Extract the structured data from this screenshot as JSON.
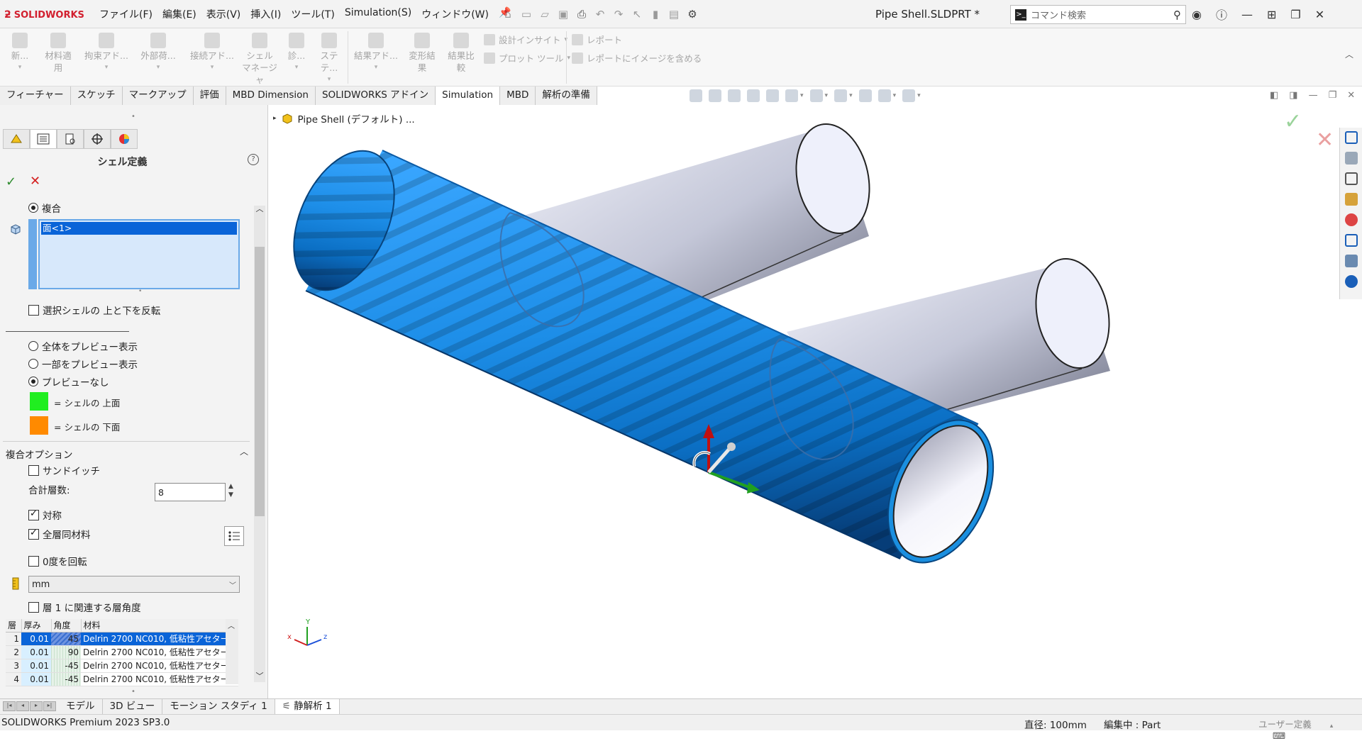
{
  "app": {
    "brand": "SOLIDWORKS",
    "document_title": "Pipe Shell.SLDPRT *",
    "menu": [
      "ファイル(F)",
      "編集(E)",
      "表示(V)",
      "挿入(I)",
      "ツール(T)",
      "Simulation(S)",
      "ウィンドウ(W)"
    ],
    "command_search_placeholder": "コマンド検索"
  },
  "command_manager": {
    "buttons": [
      {
        "label": "新...",
        "sub": ""
      },
      {
        "label": "材料適",
        "sub": "用"
      },
      {
        "label": "拘束アド...",
        "sub": ""
      },
      {
        "label": "外部荷...",
        "sub": ""
      },
      {
        "label": "接続アド...",
        "sub": ""
      },
      {
        "label": "シェル",
        "sub": "マネージャ"
      },
      {
        "label": "診...",
        "sub": ""
      },
      {
        "label": "ステテ...",
        "sub": ""
      },
      {
        "label": "結果アド...",
        "sub": ""
      },
      {
        "label": "変形結",
        "sub": "果"
      },
      {
        "label": "結果比",
        "sub": "較"
      }
    ],
    "small": [
      "設計インサイト",
      "プロット ツール",
      "レポート",
      "レポートにイメージを含める"
    ]
  },
  "tabs": [
    {
      "label": "フィーチャー",
      "active": false
    },
    {
      "label": "スケッチ",
      "active": false
    },
    {
      "label": "マークアップ",
      "active": false
    },
    {
      "label": "評価",
      "active": false
    },
    {
      "label": "MBD Dimension",
      "active": false
    },
    {
      "label": "SOLIDWORKS アドイン",
      "active": false
    },
    {
      "label": "Simulation",
      "active": true
    },
    {
      "label": "MBD",
      "active": false
    },
    {
      "label": "解析の準備",
      "active": false
    }
  ],
  "property_manager": {
    "title": "シェル定義",
    "type_composite": "複合",
    "selected_face": "面<1>",
    "flip_shell": "選択シェルの 上と下を反転",
    "preview_all": "全体をプレビュー表示",
    "preview_partial": "一部をプレビュー表示",
    "preview_none": "プレビューなし",
    "legend_top": "= シェルの 上面",
    "legend_bottom": "= シェルの 下面",
    "composite_options": "複合オプション",
    "sandwich": "サンドイッチ",
    "total_layers_label": "合計層数:",
    "total_layers": "8",
    "symmetric": "対称",
    "same_material": "全層同材料",
    "rotate_zero": "0度を回転",
    "unit": "mm",
    "angle_relative": "層 1 に関連する層角度",
    "table_headers": [
      "層",
      "厚み",
      "角度",
      "材料"
    ],
    "layers": [
      {
        "num": "1",
        "thickness": "0.01",
        "angle": "45",
        "material": "Delrin 2700 NC010, 低粘性アセタール"
      },
      {
        "num": "2",
        "thickness": "0.01",
        "angle": "90",
        "material": "Delrin 2700 NC010, 低粘性アセタール"
      },
      {
        "num": "3",
        "thickness": "0.01",
        "angle": "-45",
        "material": "Delrin 2700 NC010, 低粘性アセタール"
      },
      {
        "num": "4",
        "thickness": "0.01",
        "angle": "-45",
        "material": "Delrin 2700 NC010, 低粘性アセタール"
      }
    ],
    "colors": {
      "top": "#20ee20",
      "bottom": "#ff8a00"
    }
  },
  "tree": {
    "root": "Pipe Shell (デフォルト) ..."
  },
  "bottom_tabs": [
    {
      "label": "モデル",
      "active": false
    },
    {
      "label": "3D ビュー",
      "active": false
    },
    {
      "label": "モーション スタディ 1",
      "active": false
    },
    {
      "label": "静解析 1",
      "active": true
    }
  ],
  "status": {
    "product": "SOLIDWORKS Premium 2023 SP3.0",
    "diameter": "直径: 100mm",
    "editing": "編集中 : Part",
    "units": "ユーザー定義"
  },
  "triad_labels": {
    "x": "x",
    "y": "Y",
    "z": "z"
  },
  "colors": {
    "shell_blue": "#1a8fe0",
    "pipe_grey": "#b8bccc",
    "brand_red": "#d2202f"
  }
}
